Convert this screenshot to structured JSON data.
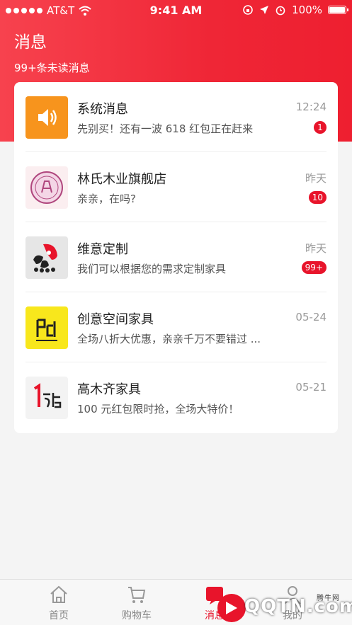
{
  "status_bar": {
    "carrier": "AT&T",
    "time": "9:41 AM",
    "battery": "100%"
  },
  "header": {
    "title": "消息",
    "unread_summary": "99+条未读消息"
  },
  "messages": [
    {
      "name": "系统消息",
      "preview": "先别买！还有一波 618 红包正在赶来",
      "time": "12:24",
      "badge": "1",
      "avatar_icon": "speaker-icon"
    },
    {
      "name": "林氏木业旗舰店",
      "preview": "亲亲，在吗?",
      "time": "昨天",
      "badge": "10",
      "avatar_icon": "linshi-logo"
    },
    {
      "name": "维意定制",
      "preview": "我们可以根据您的需求定制家具",
      "time": "昨天",
      "badge": "99+",
      "avatar_icon": "weiyi-logo"
    },
    {
      "name": "创意空间家具",
      "preview": "全场八折大优惠，亲亲千万不要错过 ...",
      "time": "05-24",
      "badge": "",
      "avatar_icon": "chuangyi-logo"
    },
    {
      "name": "高木齐家具",
      "preview": "100 元红包限时抢，全场大特价！",
      "time": "05-21",
      "badge": "",
      "avatar_icon": "gaomu-logo"
    }
  ],
  "tabbar": {
    "home": "首页",
    "cart": "购物车",
    "messages": "消息",
    "profile": "我的"
  },
  "watermark": {
    "brand": "QQTN.com",
    "small": "腾牛网"
  },
  "colors": {
    "accent": "#ee1f30",
    "badge": "#e8142b",
    "system_avatar": "#f7941d",
    "chuangyi_avatar": "#f8e71c"
  }
}
